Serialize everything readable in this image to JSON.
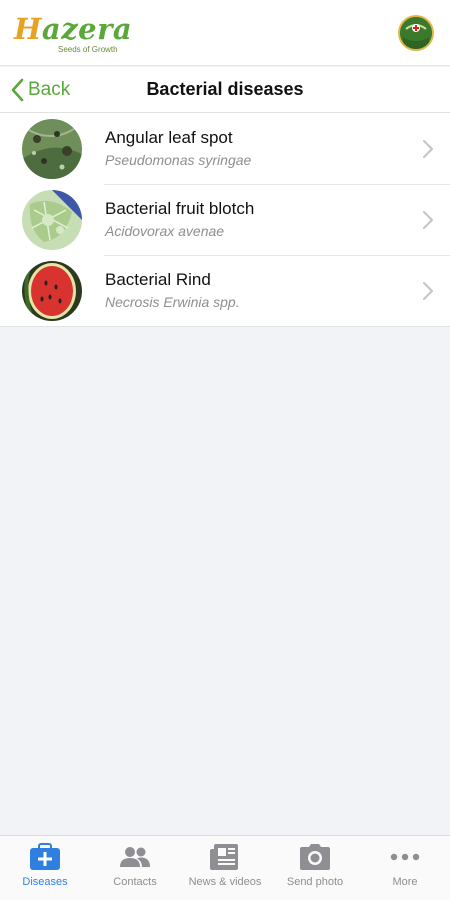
{
  "header": {
    "logo_text_h": "H",
    "logo_text_rest": "azera",
    "logo_tagline": "Seeds of Growth"
  },
  "navbar": {
    "back_label": "Back",
    "title": "Bacterial diseases"
  },
  "diseases": [
    {
      "name": "Angular leaf spot",
      "pathogen": "Pseudomonas syringae",
      "thumb": "leaf-spots"
    },
    {
      "name": "Bacterial fruit blotch",
      "pathogen": "Acidovorax avenae",
      "thumb": "leaf-blotch"
    },
    {
      "name": "Bacterial Rind",
      "pathogen": "Necrosis Erwinia spp.",
      "thumb": "watermelon"
    }
  ],
  "tabbar": {
    "items": [
      {
        "label": "Diseases",
        "icon": "medkit-icon",
        "active": true
      },
      {
        "label": "Contacts",
        "icon": "people-icon",
        "active": false
      },
      {
        "label": "News & videos",
        "icon": "newspaper-icon",
        "active": false
      },
      {
        "label": "Send photo",
        "icon": "camera-icon",
        "active": false
      },
      {
        "label": "More",
        "icon": "ellipsis-icon",
        "active": false
      }
    ]
  },
  "colors": {
    "brand_green": "#5aa83a",
    "brand_orange": "#e7a224",
    "active_tab": "#2f7fe0",
    "inactive_tab": "#8e8e93",
    "background": "#f2f3f7"
  }
}
